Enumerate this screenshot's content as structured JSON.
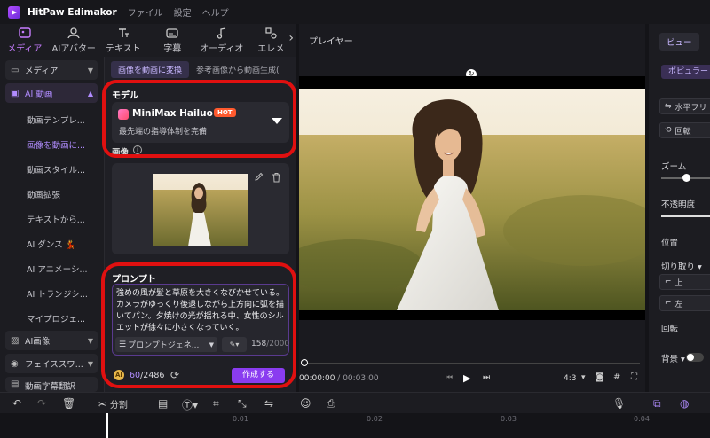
{
  "app": {
    "name": "HitPaw Edimakor",
    "menus": [
      "ファイル",
      "設定",
      "ヘルプ"
    ]
  },
  "tool_tabs": [
    {
      "label": "メディア",
      "icon": "media-icon",
      "active": true
    },
    {
      "label": "AIアバター",
      "icon": "avatar-icon"
    },
    {
      "label": "テキスト",
      "icon": "text-icon"
    },
    {
      "label": "字幕",
      "icon": "subtitle-icon"
    },
    {
      "label": "オーディオ",
      "icon": "audio-icon"
    },
    {
      "label": "エレメ",
      "icon": "element-icon"
    }
  ],
  "sidebar": {
    "media": "メディア",
    "ai_video": "AI 動画",
    "sub_items": [
      "動画テンプレ...",
      "画像を動画に...",
      "動画スタイル...",
      "動画拡張",
      "テキストから...",
      "AI ダンス 💃",
      "AI アニメーシ...",
      "AI トランジシ...",
      "マイプロジェ..."
    ],
    "ai_image": "AI画像",
    "face_swap": "フェイススワ...",
    "video_ocr": "動画字幕翻訳"
  },
  "panel": {
    "tab_active": "画像を動画に変換",
    "tab_other": "参考画像から動画生成(",
    "model_label": "モデル",
    "model_name": "MiniMax Hailuo 02",
    "model_badge": "HOT",
    "model_desc": "最先端の指導体制を完備",
    "image_label": "画像",
    "prompt_label": "プロンプト",
    "prompt_text": "強めの風が髪と草原を大きくなびかせている。カメラがゆっくり後退しながら上方向に弧を描いてパン。夕焼けの光が揺れる中、女性のシルエットが徐々に小さくなっていく。",
    "prompt_generator": "プロンプトジェネ...",
    "char_count": "158",
    "char_max": "/2000",
    "credits_used": "60",
    "credits_total": "/2486",
    "create_button": "作成する"
  },
  "player": {
    "title": "プレイヤー",
    "time_current": "00:00:00",
    "time_total": "/ 00:03:00",
    "ratio": "4:3"
  },
  "right_panel": {
    "tab": "ビュー",
    "chip": "ポピュラー",
    "flip": "水平フリ",
    "rotate": "回転",
    "zoom": "ズーム",
    "opacity": "不透明度",
    "position": "位置",
    "crop": "切り取り",
    "up": "上",
    "left": "左",
    "rotation": "回転",
    "background": "背景"
  },
  "timeline": {
    "split_label": "分割",
    "ruler": [
      "0:01",
      "0:02",
      "0:03",
      "0:04"
    ]
  }
}
